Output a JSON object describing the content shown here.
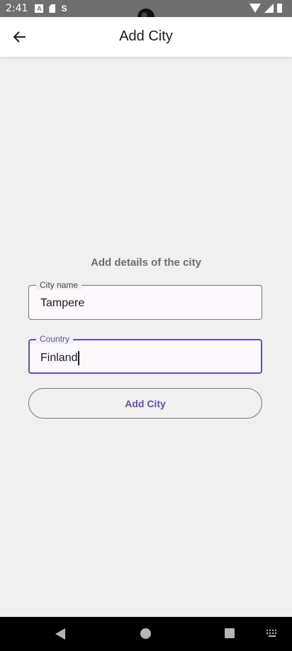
{
  "status_bar": {
    "time": "2:41",
    "icons_left": [
      "a-notification-icon",
      "sd-card-icon",
      "s-notification-icon"
    ],
    "icons_right": [
      "wifi-icon",
      "signal-icon",
      "battery-icon"
    ],
    "s_glyph": "S"
  },
  "app_bar": {
    "title": "Add City",
    "back_icon": "arrow-back-icon"
  },
  "form": {
    "heading": "Add details of the city",
    "city_field": {
      "label": "City name",
      "value": "Tampere"
    },
    "country_field": {
      "label": "Country",
      "value": "Finland",
      "focused": true
    },
    "submit_label": "Add City"
  },
  "nav_bar": {
    "icons": [
      "nav-back-icon",
      "nav-home-icon",
      "nav-recents-icon",
      "keyboard-icon"
    ]
  },
  "colors": {
    "accent": "#6750a4",
    "background": "#f0f0f0",
    "surface": "#ffffff",
    "field_fill": "#fcf8fc",
    "outline": "#7a7680",
    "status_bar": "#6f6f6f",
    "nav_bar": "#000000"
  }
}
